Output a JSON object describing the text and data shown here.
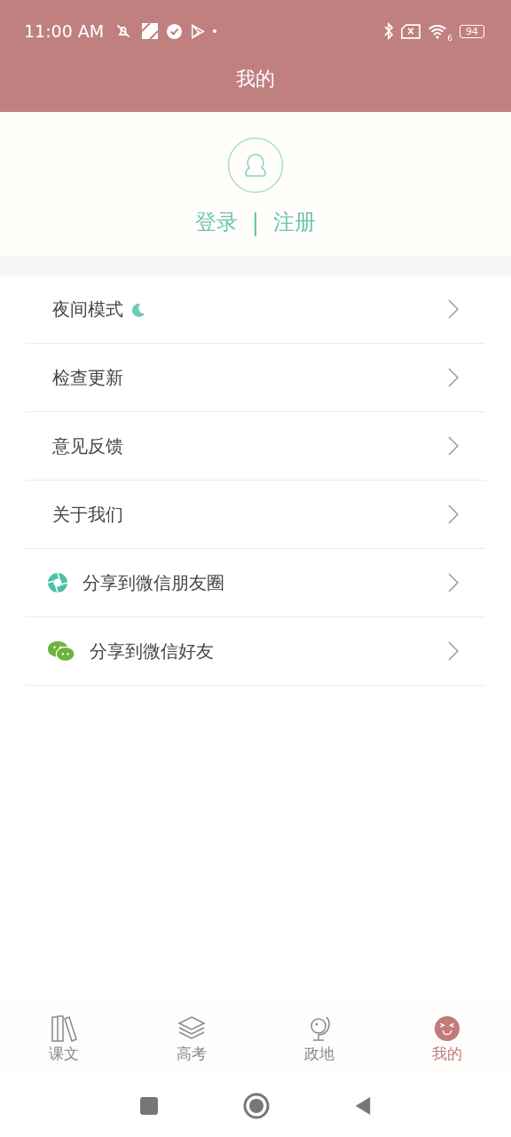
{
  "status_bar": {
    "time": "11:00 AM",
    "wifi_label": "6",
    "battery": "94"
  },
  "header": {
    "title": "我的"
  },
  "profile": {
    "login": "登录",
    "separator": "|",
    "register": "注册"
  },
  "menu": [
    {
      "label": "夜间模式",
      "kind": "night"
    },
    {
      "label": "检查更新",
      "kind": "plain"
    },
    {
      "label": "意见反馈",
      "kind": "plain"
    },
    {
      "label": "关于我们",
      "kind": "plain"
    },
    {
      "label": "分享到微信朋友圈",
      "kind": "moments"
    },
    {
      "label": "分享到微信好友",
      "kind": "wechat"
    }
  ],
  "tabs": [
    {
      "label": "课文",
      "kind": "books",
      "selected": false
    },
    {
      "label": "高考",
      "kind": "layers",
      "selected": false
    },
    {
      "label": "政地",
      "kind": "globe",
      "selected": false
    },
    {
      "label": "我的",
      "kind": "face",
      "selected": true
    }
  ]
}
